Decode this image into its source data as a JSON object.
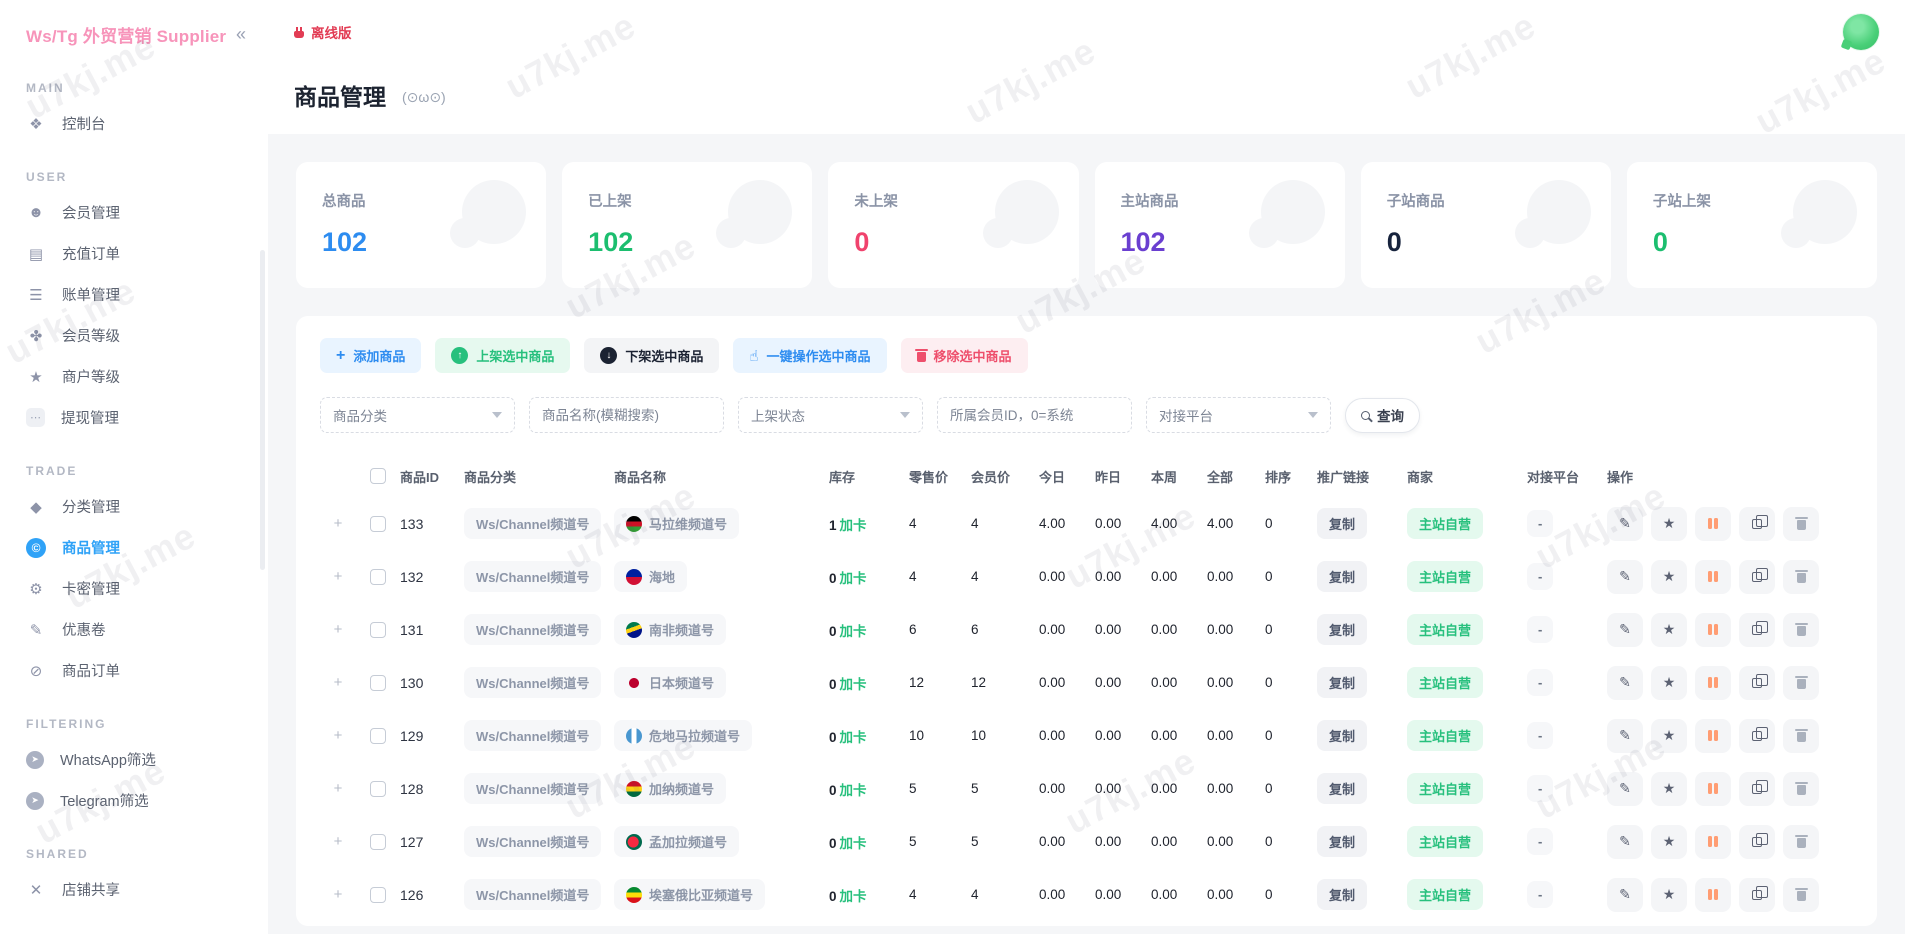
{
  "watermark": "u7kj.me",
  "sidebar": {
    "logo": "Ws/Tg 外贸营销 Supplier",
    "collapse_icon": "«",
    "sections": [
      {
        "title": "MAIN",
        "items": [
          {
            "icon": "❖",
            "label": "控制台"
          }
        ]
      },
      {
        "title": "USER",
        "items": [
          {
            "icon": "☻",
            "label": "会员管理"
          },
          {
            "icon": "▤",
            "label": "充值订单"
          },
          {
            "icon": "☰",
            "label": "账单管理"
          },
          {
            "icon": "✤",
            "label": "会员等级"
          },
          {
            "icon": "★",
            "label": "商户等级"
          },
          {
            "icon": "⋯",
            "label": "提现管理"
          }
        ]
      },
      {
        "title": "TRADE",
        "items": [
          {
            "icon": "◆",
            "label": "分类管理"
          },
          {
            "icon": "©",
            "label": "商品管理",
            "active": true
          },
          {
            "icon": "⚙",
            "label": "卡密管理"
          },
          {
            "icon": "✎",
            "label": "优惠卷"
          },
          {
            "icon": "⊘",
            "label": "商品订单"
          }
        ]
      },
      {
        "title": "FILTERING",
        "items": [
          {
            "icon": "➤",
            "label": "WhatsApp筛选"
          },
          {
            "icon": "➤",
            "label": "Telegram筛选"
          }
        ]
      },
      {
        "title": "SHARED",
        "items": [
          {
            "icon": "✕",
            "label": "店铺共享"
          }
        ]
      }
    ]
  },
  "header": {
    "offline_label": "离线版",
    "page_title": "商品管理",
    "emoticon": "(⊙ω⊙)"
  },
  "stats": {
    "items": [
      {
        "label": "总商品",
        "value": "102",
        "color": "#2d8cf0"
      },
      {
        "label": "已上架",
        "value": "102",
        "color": "#1cbe6f"
      },
      {
        "label": "未上架",
        "value": "0",
        "color": "#f0436d"
      },
      {
        "label": "主站商品",
        "value": "102",
        "color": "#6a3fd0"
      },
      {
        "label": "子站商品",
        "value": "0",
        "color": "#17233d"
      },
      {
        "label": "子站上架",
        "value": "0",
        "color": "#1cbe6f"
      }
    ]
  },
  "toolbar": {
    "buttons": [
      {
        "icon": "+",
        "label": "添加商品"
      },
      {
        "icon": "↑",
        "label": "上架选中商品"
      },
      {
        "icon": "↓",
        "label": "下架选中商品"
      },
      {
        "icon": "☝",
        "label": "一键操作选中商品"
      },
      {
        "icon": "",
        "label": "移除选中商品"
      }
    ]
  },
  "filters": {
    "category_placeholder": "商品分类",
    "name_placeholder": "商品名称(模糊搜索)",
    "status_placeholder": "上架状态",
    "member_placeholder": "所属会员ID，0=系统",
    "platform_placeholder": "对接平台",
    "search_label": "查询"
  },
  "table": {
    "headers": [
      "商品ID",
      "商品分类",
      "商品名称",
      "库存",
      "零售价",
      "会员价",
      "今日",
      "昨日",
      "本周",
      "全部",
      "排序",
      "推广链接",
      "商家",
      "对接平台",
      "操作"
    ],
    "labels": {
      "expander": "+",
      "stock_action": "加卡",
      "promo": "复制",
      "merchant": "主站自营",
      "platform": "-"
    },
    "rows": [
      {
        "id": "133",
        "category": "Ws/Channel频道号",
        "name": "马拉维频道号",
        "flag": "linear-gradient(180deg,#000000 33%,#ce1126 33%,#ce1126 66%,#339e35 66%)",
        "stock": "1",
        "retail": "4",
        "member": "4",
        "today": "4.00",
        "yesterday": "0.00",
        "week": "4.00",
        "all": "4.00",
        "sort": "0"
      },
      {
        "id": "132",
        "category": "Ws/Channel频道号",
        "name": "海地",
        "flag": "linear-gradient(180deg,#00209f 50%,#d21034 50%)",
        "stock": "0",
        "retail": "4",
        "member": "4",
        "today": "0.00",
        "yesterday": "0.00",
        "week": "0.00",
        "all": "0.00",
        "sort": "0"
      },
      {
        "id": "131",
        "category": "Ws/Channel频道号",
        "name": "南非频道号",
        "flag": "linear-gradient(160deg,#007a4d 35%,#fcd116 35%,#fcd116 55%,#001489 55%)",
        "stock": "0",
        "retail": "6",
        "member": "6",
        "today": "0.00",
        "yesterday": "0.00",
        "week": "0.00",
        "all": "0.00",
        "sort": "0"
      },
      {
        "id": "130",
        "category": "Ws/Channel频道号",
        "name": "日本频道号",
        "flag": "radial-gradient(circle at 50% 50%,#bc002d 42%,rgba(188,0,45,0) 46%)",
        "stock": "0",
        "retail": "12",
        "member": "12",
        "today": "0.00",
        "yesterday": "0.00",
        "week": "0.00",
        "all": "0.00",
        "sort": "0"
      },
      {
        "id": "129",
        "category": "Ws/Channel频道号",
        "name": "危地马拉频道号",
        "flag": "linear-gradient(90deg,#4997d0 33%,#ffffff 33%,#ffffff 66%,#4997d0 66%)",
        "stock": "0",
        "retail": "10",
        "member": "10",
        "today": "0.00",
        "yesterday": "0.00",
        "week": "0.00",
        "all": "0.00",
        "sort": "0"
      },
      {
        "id": "128",
        "category": "Ws/Channel频道号",
        "name": "加纳频道号",
        "flag": "linear-gradient(180deg,#ce1126 33%,#fcd116 33%,#fcd116 66%,#006b3f 66%)",
        "stock": "0",
        "retail": "5",
        "member": "5",
        "today": "0.00",
        "yesterday": "0.00",
        "week": "0.00",
        "all": "0.00",
        "sort": "0"
      },
      {
        "id": "127",
        "category": "Ws/Channel频道号",
        "name": "孟加拉频道号",
        "flag": "radial-gradient(circle at 45% 50%,#f42a41 45%,#006a4e 48%)",
        "stock": "0",
        "retail": "5",
        "member": "5",
        "today": "0.00",
        "yesterday": "0.00",
        "week": "0.00",
        "all": "0.00",
        "sort": "0"
      },
      {
        "id": "126",
        "category": "Ws/Channel频道号",
        "name": "埃塞俄比亚频道号",
        "flag": "linear-gradient(180deg,#078930 33%,#fcdd09 33%,#fcdd09 66%,#da121a 66%)",
        "stock": "0",
        "retail": "4",
        "member": "4",
        "today": "0.00",
        "yesterday": "0.00",
        "week": "0.00",
        "all": "0.00",
        "sort": "0"
      }
    ]
  }
}
